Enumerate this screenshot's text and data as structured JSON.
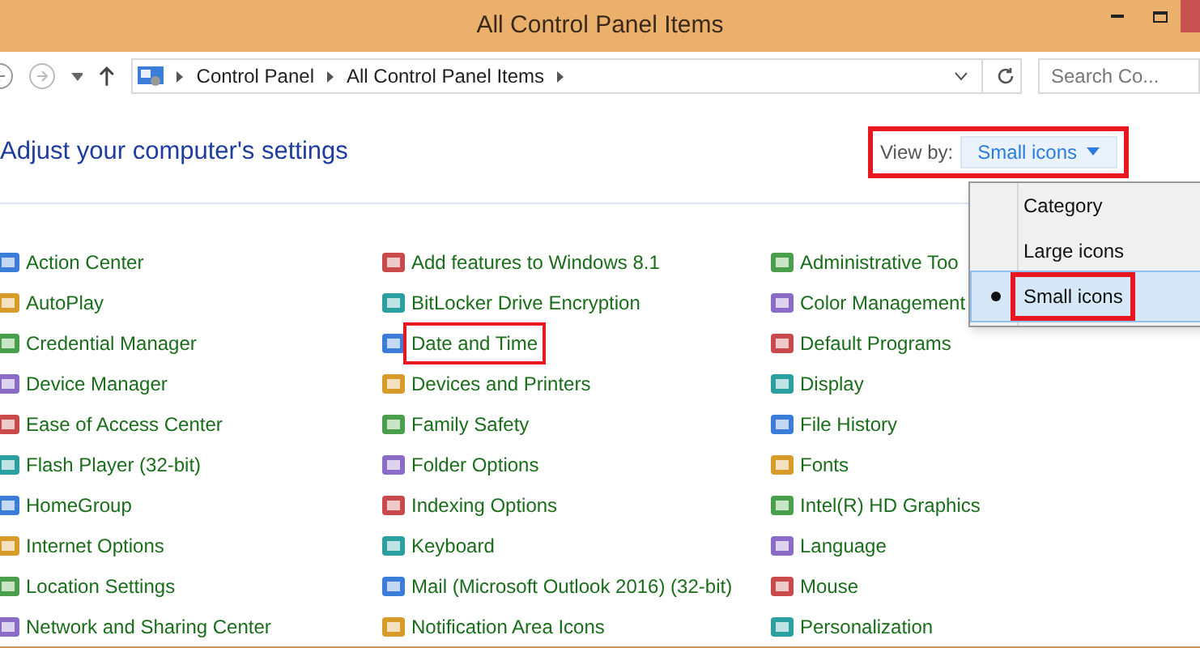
{
  "window": {
    "title": "All Control Panel Items"
  },
  "address_bar": {
    "path": [
      "Control Panel",
      "All Control Panel Items"
    ]
  },
  "search": {
    "placeholder": "Search Co..."
  },
  "heading": "Adjust your computer's settings",
  "view_by": {
    "label": "View by:",
    "value": "Small icons",
    "highlighted": true
  },
  "view_menu": [
    {
      "label": "Category",
      "selected": false,
      "highlighted": false
    },
    {
      "label": "Large icons",
      "selected": false,
      "highlighted": false
    },
    {
      "label": "Small icons",
      "selected": true,
      "highlighted": true
    }
  ],
  "columns": [
    [
      {
        "label": "Action Center",
        "highlighted": false
      },
      {
        "label": "AutoPlay",
        "highlighted": false
      },
      {
        "label": "Credential Manager",
        "highlighted": false
      },
      {
        "label": "Device Manager",
        "highlighted": false
      },
      {
        "label": "Ease of Access Center",
        "highlighted": false
      },
      {
        "label": "Flash Player (32-bit)",
        "highlighted": false
      },
      {
        "label": "HomeGroup",
        "highlighted": false
      },
      {
        "label": "Internet Options",
        "highlighted": false
      },
      {
        "label": "Location Settings",
        "highlighted": false
      },
      {
        "label": "Network and Sharing Center",
        "highlighted": false
      }
    ],
    [
      {
        "label": "Add features to Windows 8.1",
        "highlighted": false
      },
      {
        "label": "BitLocker Drive Encryption",
        "highlighted": false
      },
      {
        "label": "Date and Time",
        "highlighted": true
      },
      {
        "label": "Devices and Printers",
        "highlighted": false
      },
      {
        "label": "Family Safety",
        "highlighted": false
      },
      {
        "label": "Folder Options",
        "highlighted": false
      },
      {
        "label": "Indexing Options",
        "highlighted": false
      },
      {
        "label": "Keyboard",
        "highlighted": false
      },
      {
        "label": "Mail (Microsoft Outlook 2016) (32-bit)",
        "highlighted": false
      },
      {
        "label": "Notification Area Icons",
        "highlighted": false
      }
    ],
    [
      {
        "label": "Administrative Too",
        "highlighted": false
      },
      {
        "label": "Color Management",
        "highlighted": false
      },
      {
        "label": "Default Programs",
        "highlighted": false
      },
      {
        "label": "Display",
        "highlighted": false
      },
      {
        "label": "File History",
        "highlighted": false
      },
      {
        "label": "Fonts",
        "highlighted": false
      },
      {
        "label": "Intel(R) HD Graphics",
        "highlighted": false
      },
      {
        "label": "Language",
        "highlighted": false
      },
      {
        "label": "Mouse",
        "highlighted": false
      },
      {
        "label": "Personalization",
        "highlighted": false
      }
    ]
  ]
}
